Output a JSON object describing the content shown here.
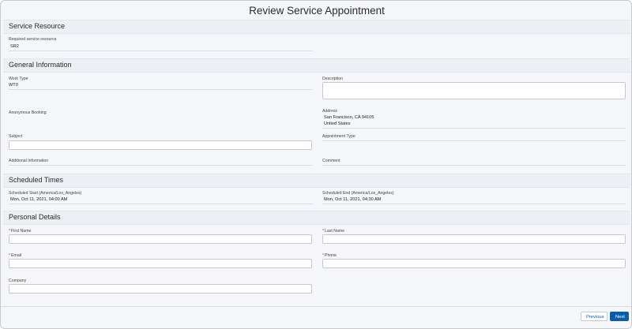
{
  "page": {
    "title": "Review Service Appointment"
  },
  "sections": {
    "service_resource": "Service Resource",
    "general_information": "General Information",
    "scheduled_times": "Scheduled Times",
    "personal_details": "Personal Details"
  },
  "fields": {
    "required_service_resource": {
      "label": "Required service resource",
      "value": "SR2"
    },
    "work_type": {
      "label": "Work Type",
      "value": "WT0"
    },
    "description": {
      "label": "Description",
      "value": ""
    },
    "anonymous_booking": {
      "label": "Anonymous Booking"
    },
    "address": {
      "label": "Address",
      "line1": "San Francisco, CA 94105",
      "line2": "United States"
    },
    "subject": {
      "label": "Subject",
      "value": ""
    },
    "appointment_type": {
      "label": "Appointment Type"
    },
    "additional_information": {
      "label": "Additional Information"
    },
    "comment": {
      "label": "Comment"
    },
    "scheduled_start": {
      "label": "Scheduled Start (America/Los_Angeles)",
      "value": "Mon, Oct 11, 2021, 04:00 AM"
    },
    "scheduled_end": {
      "label": "Scheduled End (America/Los_Angeles)",
      "value": "Mon, Oct 11, 2021, 04:30 AM"
    },
    "first_name": {
      "label": "First Name",
      "required_marker": "*",
      "value": ""
    },
    "last_name": {
      "label": "Last Name",
      "required_marker": "*",
      "value": ""
    },
    "email": {
      "label": "Email",
      "required_marker": "*",
      "value": ""
    },
    "phone": {
      "label": "Phone",
      "required_marker": "*",
      "value": ""
    },
    "company": {
      "label": "Company",
      "value": ""
    }
  },
  "footer": {
    "previous_label": "Previous",
    "next_label": "Next"
  },
  "colors": {
    "brand": "#0b5cab",
    "required": "#c23934",
    "background": "#f4f6f9"
  }
}
